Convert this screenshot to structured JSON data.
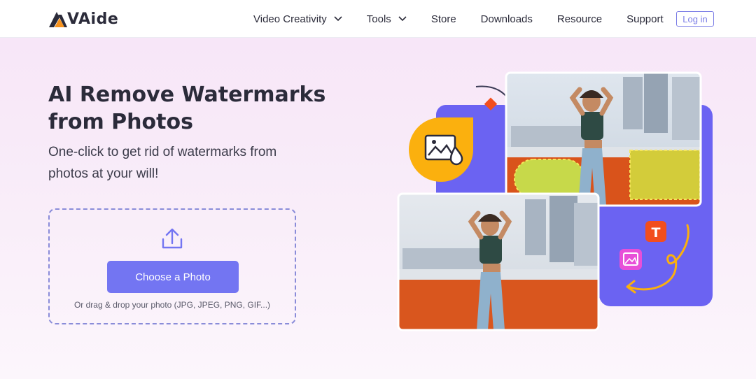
{
  "brand": {
    "name": "VAide",
    "logo_accent": "#f7931e"
  },
  "nav": {
    "items": [
      {
        "label": "Video Creativity",
        "dropdown": true
      },
      {
        "label": "Tools",
        "dropdown": true
      },
      {
        "label": "Store",
        "dropdown": false
      },
      {
        "label": "Downloads",
        "dropdown": false
      },
      {
        "label": "Resource",
        "dropdown": false
      },
      {
        "label": "Support",
        "dropdown": false
      }
    ],
    "login_label": "Log in"
  },
  "hero": {
    "title_line1": "AI Remove Watermarks",
    "title_line2": "from Photos",
    "subtitle_line1": "One-click to get rid of watermarks from",
    "subtitle_line2": "photos at your will!",
    "upload": {
      "button_label": "Choose a Photo",
      "hint": "Or drag & drop your photo (JPG, JPEG, PNG, GIF...)"
    }
  },
  "illustration": {
    "badge_text": "T"
  },
  "colors": {
    "accent": "#7375f2",
    "orange": "#f7931e",
    "purple_panel": "#6b63f2",
    "badge_red": "#f24e1e",
    "badge_pink": "#e84fd8"
  }
}
